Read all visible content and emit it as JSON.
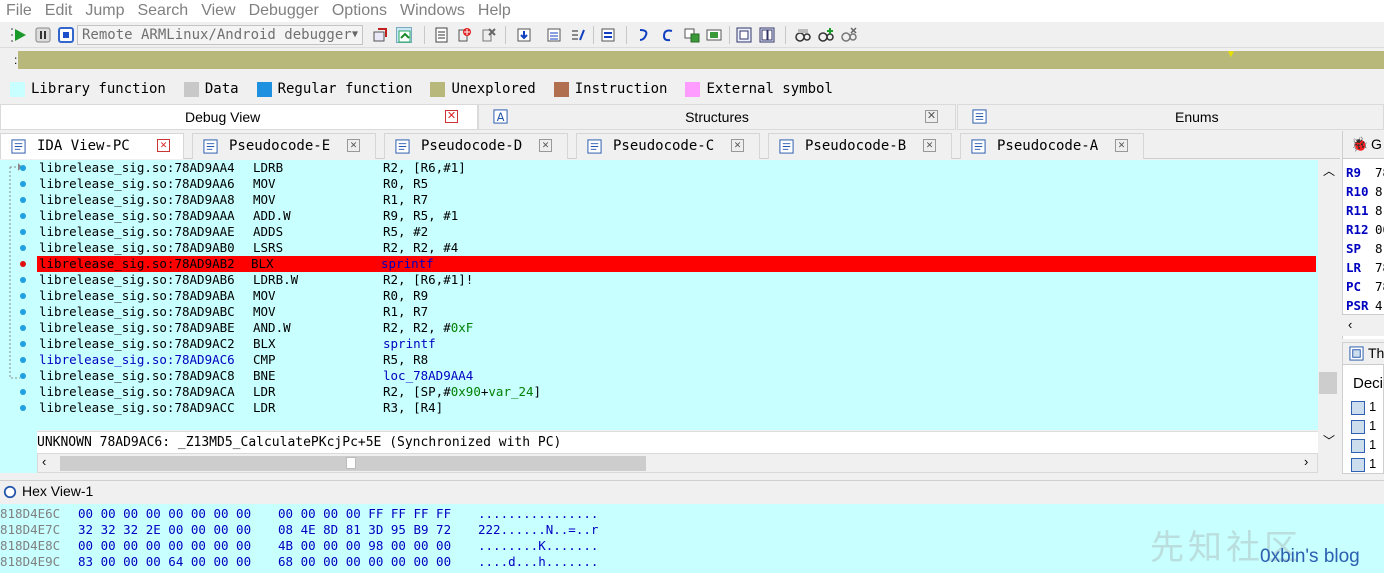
{
  "menu": [
    "File",
    "Edit",
    "Jump",
    "Search",
    "View",
    "Debugger",
    "Options",
    "Windows",
    "Help"
  ],
  "toolbar": {
    "debugger": "Remote ARMLinux/Android debugger"
  },
  "colors": {
    "library_function": "#c8ffff",
    "data": "#c8c8c8",
    "regular_function": "#1e90e0",
    "unexplored": "#b8b87a",
    "instruction": "#b07050",
    "external_symbol": "#ff9cff",
    "highlight": "#ff0000"
  },
  "legend": [
    {
      "label": "Library function",
      "color": "#c8ffff"
    },
    {
      "label": "Data",
      "color": "#c8c8c8"
    },
    {
      "label": "Regular function",
      "color": "#1e90e0"
    },
    {
      "label": "Unexplored",
      "color": "#b8b87a"
    },
    {
      "label": "Instruction",
      "color": "#b07050"
    },
    {
      "label": "External symbol",
      "color": "#ff9cff"
    }
  ],
  "panes": {
    "debug_view": "Debug View",
    "structures": "Structures",
    "enums": "Enums"
  },
  "tabs": [
    "IDA View-PC",
    "Pseudocode-E",
    "Pseudocode-D",
    "Pseudocode-C",
    "Pseudocode-B",
    "Pseudocode-A"
  ],
  "disasm": [
    {
      "addr": "librelease_sig.so:78AD9AA4",
      "mn": "LDRB",
      "op": "R2, [R6,#1]"
    },
    {
      "addr": "librelease_sig.so:78AD9AA6",
      "mn": "MOV",
      "op": "R0, R5"
    },
    {
      "addr": "librelease_sig.so:78AD9AA8",
      "mn": "MOV",
      "op": "R1, R7"
    },
    {
      "addr": "librelease_sig.so:78AD9AAA",
      "mn": "ADD.W",
      "op": "R9, R5, #1"
    },
    {
      "addr": "librelease_sig.so:78AD9AAE",
      "mn": "ADDS",
      "op": "R5, #2"
    },
    {
      "addr": "librelease_sig.so:78AD9AB0",
      "mn": "LSRS",
      "op": "R2, R2, #4"
    },
    {
      "addr": "librelease_sig.so:78AD9AB2",
      "mn": "BLX",
      "op": "sprintf"
    },
    {
      "addr": "librelease_sig.so:78AD9AB6",
      "mn": "LDRB.W",
      "op": "R2, [R6,#1]!"
    },
    {
      "addr": "librelease_sig.so:78AD9ABA",
      "mn": "MOV",
      "op": "R0, R9"
    },
    {
      "addr": "librelease_sig.so:78AD9ABC",
      "mn": "MOV",
      "op": "R1, R7"
    },
    {
      "addr": "librelease_sig.so:78AD9ABE",
      "mn": "AND.W",
      "op": "R2, R2, #0xF"
    },
    {
      "addr": "librelease_sig.so:78AD9AC2",
      "mn": "BLX",
      "op": "sprintf"
    },
    {
      "addr": "librelease_sig.so:78AD9AC6",
      "mn": "CMP",
      "op": "R5, R8"
    },
    {
      "addr": "librelease_sig.so:78AD9AC8",
      "mn": "BNE",
      "op": "loc_78AD9AA4"
    },
    {
      "addr": "librelease_sig.so:78AD9ACA",
      "mn": "LDR",
      "op": "R2, [SP,#0x90+var_24]"
    },
    {
      "addr": "librelease_sig.so:78AD9ACC",
      "mn": "LDR",
      "op": "R3, [R4]"
    }
  ],
  "status": "UNKNOWN 78AD9AC6: _Z13MD5_CalculatePKcjPc+5E (Synchronized with PC)",
  "registers": [
    {
      "name": "R9",
      "val": "78"
    },
    {
      "name": "R10",
      "val": "8"
    },
    {
      "name": "R11",
      "val": "8"
    },
    {
      "name": "R12",
      "val": "00"
    },
    {
      "name": "SP",
      "val": "8"
    },
    {
      "name": "LR",
      "val": "78"
    },
    {
      "name": "PC",
      "val": "78"
    },
    {
      "name": "PSR",
      "val": "4"
    }
  ],
  "regpanel_title": "G",
  "threads": {
    "title": "Th",
    "column": "Deci",
    "rows": [
      "1",
      "1",
      "1",
      "1"
    ]
  },
  "hex": {
    "title": "Hex View-1",
    "rows": [
      {
        "addr": "818D4E6C",
        "b1": "00 00 00 00 00 00 00 00",
        "b2": "00 00 00 00 FF FF FF FF",
        "s": "................"
      },
      {
        "addr": "818D4E7C",
        "b1": "32 32 32 2E 00 00 00 00",
        "b2": "08 4E 8D 81 3D 95 B9 72",
        "s": "222......N..=..r"
      },
      {
        "addr": "818D4E8C",
        "b1": "00 00 00 00 00 00 00 00",
        "b2": "4B 00 00 00 98 00 00 00",
        "s": "........K......."
      },
      {
        "addr": "818D4E9C",
        "b1": "83 00 00 00 64 00 00 00",
        "b2": "68 00 00 00 00 00 00 00",
        "s": "....d...h......."
      }
    ]
  },
  "watermark": "0xbin's blog",
  "watermark_bg": "先知社区"
}
